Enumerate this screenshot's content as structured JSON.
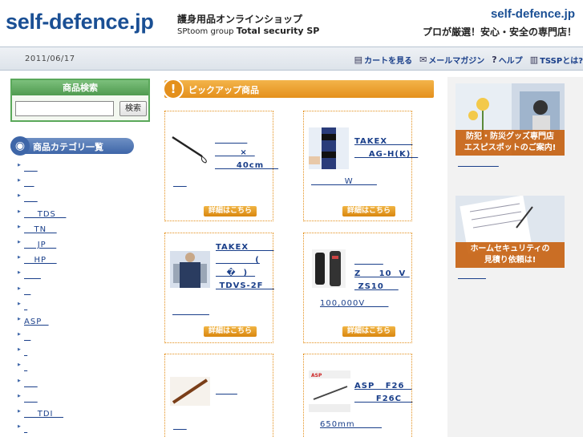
{
  "header": {
    "logo": "self-defence.jp",
    "tagline1": "護身用品オンラインショップ",
    "tagline2_prefix": "SPtoom group ",
    "tagline2_bold": "Total security SP",
    "site_name": "self-defence.jp",
    "slogan": "プロが厳選！安心・安全の専門店！"
  },
  "navbar": {
    "date": "2011/06/17",
    "links": [
      {
        "label": "カートを見る",
        "icon": "cart-icon",
        "glyph": "🛒"
      },
      {
        "label": "メールマガジン",
        "icon": "mail-icon",
        "glyph": "✉"
      },
      {
        "label": "ヘルプ",
        "icon": "help-icon",
        "glyph": "?"
      },
      {
        "label": "TSSPとは?",
        "icon": "info-icon",
        "glyph": "ⓘ"
      }
    ]
  },
  "search": {
    "title": "商品検索",
    "button": "検索",
    "value": ""
  },
  "categories": {
    "title": "商品カテゴリ一覧",
    "items": [
      "    ",
      "   ",
      "    ",
      "    TDS   ",
      "   TN   ",
      "    JP   ",
      "   HP   ",
      "     ",
      "  ",
      " ",
      "ASP  ",
      "  ",
      " ",
      " ",
      "    ",
      "    ",
      "    TDI   ",
      " "
    ]
  },
  "pickup": {
    "title": "ピックアップ商品",
    "detail_label": "詳細はこちら",
    "products": [
      {
        "name": "         \n       ×  \n      40cm    ",
        "price": "    "
      },
      {
        "name": "TAKEX       \n    AG-H(K)  ",
        "price": "          W       "
      },
      {
        "name": "TAKEX       \n           (\n   �  )  \n TDVS-2F   ",
        "price": "           "
      },
      {
        "name": "        \nZ     10  V \n ZS10    ",
        "price": "100,000V       "
      },
      {
        "name": "      ",
        "price": "    "
      },
      {
        "name": "ASP   F26  \n      F26C   ",
        "price": "650mm        "
      }
    ]
  },
  "banners": [
    {
      "caption1": "防犯・防災グッズ専門店",
      "caption2": "エスピスポットのご案内!",
      "link": "                "
    },
    {
      "caption1": "ホームセキュリティの",
      "caption2": "見積り依頼は!",
      "link": "           "
    }
  ]
}
